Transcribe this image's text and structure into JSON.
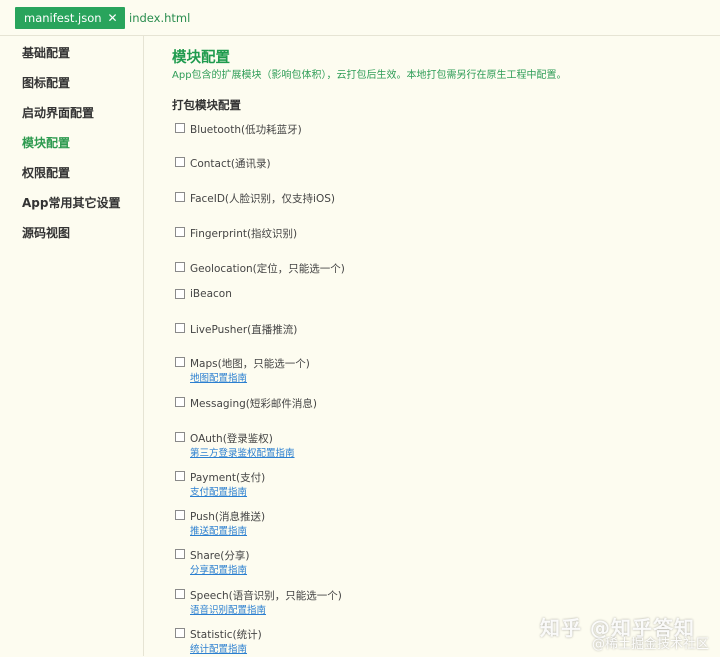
{
  "tabs": [
    {
      "label": "manifest.json",
      "active": true
    },
    {
      "label": "index.html",
      "active": false
    }
  ],
  "sidebar": {
    "items": [
      {
        "label": "基础配置",
        "active": false
      },
      {
        "label": "图标配置",
        "active": false
      },
      {
        "label": "启动界面配置",
        "active": false
      },
      {
        "label": "模块配置",
        "active": true
      },
      {
        "label": "权限配置",
        "active": false
      },
      {
        "label": "App常用其它设置",
        "active": false
      },
      {
        "label": "源码视图",
        "active": false
      }
    ]
  },
  "main": {
    "title": "模块配置",
    "description": "App包含的扩展模块（影响包体积），云打包后生效。本地打包需另行在原生工程中配置。",
    "group_title": "打包模块配置",
    "modules": [
      {
        "label": "Bluetooth(低功耗蓝牙)",
        "link": ""
      },
      {
        "label": "Contact(通讯录)",
        "link": ""
      },
      {
        "label": "FaceID(人脸识别，仅支持iOS)",
        "link": ""
      },
      {
        "label": "Fingerprint(指纹识别)",
        "link": ""
      },
      {
        "label": "Geolocation(定位，只能选一个)",
        "link": ""
      },
      {
        "label": "iBeacon",
        "link": ""
      },
      {
        "label": "LivePusher(直播推流)",
        "link": ""
      },
      {
        "label": "Maps(地图，只能选一个)",
        "link": "地图配置指南"
      },
      {
        "label": "Messaging(短彩邮件消息)",
        "link": ""
      },
      {
        "label": "OAuth(登录鉴权)",
        "link": "第三方登录鉴权配置指南"
      },
      {
        "label": "Payment(支付)",
        "link": "支付配置指南"
      },
      {
        "label": "Push(消息推送)",
        "link": "推送配置指南"
      },
      {
        "label": "Share(分享)",
        "link": "分享配置指南"
      },
      {
        "label": "Speech(语音识别，只能选一个)",
        "link": "语音识别配置指南"
      },
      {
        "label": "Statistic(统计)",
        "link": "统计配置指南"
      }
    ]
  },
  "watermark": {
    "line1": "知乎 @知乎答知",
    "line2": "@稀土掘金技术社区"
  }
}
